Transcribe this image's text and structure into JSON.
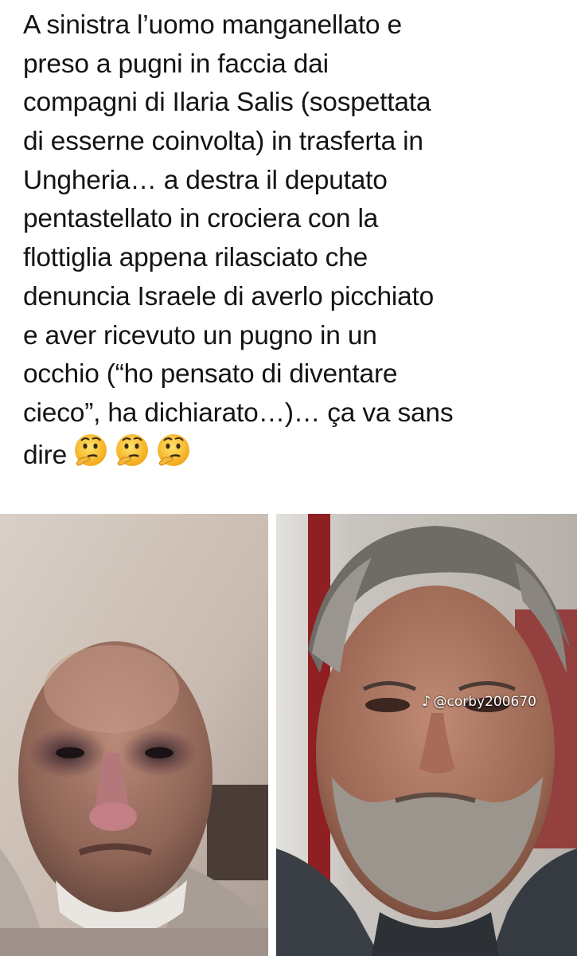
{
  "post": {
    "lines": [
      "A sinistra l’uomo manganellato e",
      "preso a pugni in faccia  dai",
      "compagni di Ilaria Salis (sospettata",
      "di esserne coinvolta) in trasferta in",
      "Ungheria… a destra il deputato",
      "pentastellato in crociera con la",
      "flottiglia appena rilasciato che",
      "denuncia Israele di averlo picchiato",
      "e aver ricevuto un pugno in un",
      "occhio (“ho pensato di diventare",
      "cieco”, ha dichiarato…)… ça va sans",
      "dire"
    ],
    "emojis": [
      "thinking-face-icon",
      "thinking-face-icon",
      "thinking-face-icon"
    ]
  },
  "photos": {
    "left_alt": "Bald man with bruised black eyes and bandage on neck",
    "right_alt": "Man with wet gray hair and beard looking down"
  },
  "watermark": {
    "platform_icon": "tiktok-icon",
    "handle": "@corby200670"
  }
}
